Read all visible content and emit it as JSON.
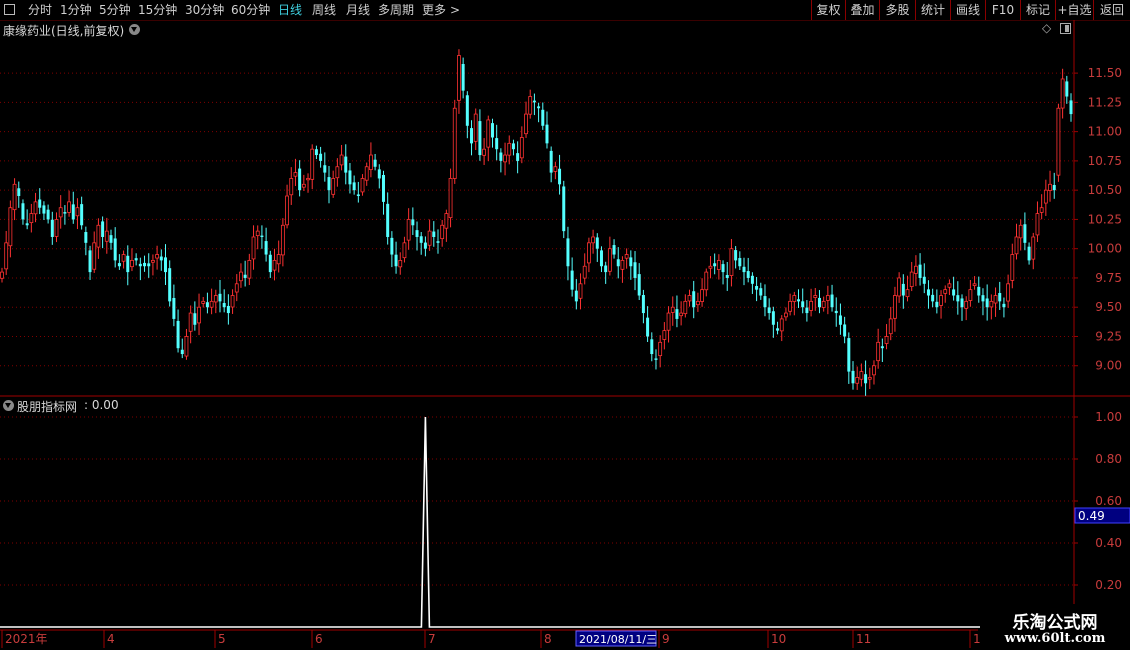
{
  "toolbar": {
    "periods": [
      "分时",
      "1分钟",
      "5分钟",
      "15分钟",
      "30分钟",
      "60分钟",
      "日线",
      "周线",
      "月线",
      "多周期",
      "更多"
    ],
    "active_period": "日线",
    "more_arrow": ">",
    "buttons": [
      "复权",
      "叠加",
      "多股",
      "统计",
      "画线",
      "F10",
      "标记",
      "+自选",
      "返回"
    ]
  },
  "main_panel": {
    "stock_title": "康缘药业(日线,前复权)",
    "dropdown_icon": "chevron-down-icon",
    "diamond_icon": "◇",
    "layout_icon": "panel-toggle-icon"
  },
  "indicator_panel": {
    "title": "股朋指标网",
    "value_text": ": 0.00",
    "cursor_value": "0.49"
  },
  "date_axis": {
    "labels": [
      "2021年",
      "4",
      "5",
      "6",
      "7",
      "8",
      "9",
      "10",
      "11",
      "1"
    ],
    "cursor_date": "2021/08/11/三"
  },
  "watermark": {
    "line1": "乐淘公式网",
    "line2": "www.60lt.com"
  },
  "colors": {
    "up": "#ff3232",
    "down": "#54ffff",
    "grid": "#800000",
    "axis_text": "#c83c3c",
    "indicator_line": "#ffffff",
    "cursor_box": "#000080"
  },
  "chart_data": [
    {
      "type": "candlestick",
      "title": "康缘药业(日线,前复权)",
      "y_ticks": [
        9.0,
        9.25,
        9.5,
        9.75,
        10.0,
        10.25,
        10.5,
        10.75,
        11.0,
        11.25,
        11.5
      ],
      "ylim": [
        8.75,
        11.8
      ],
      "x_month_labels": [
        "2021年",
        "4",
        "5",
        "6",
        "7",
        "8",
        "9",
        "10",
        "11",
        "1"
      ],
      "close": [
        9.8,
        10.05,
        10.35,
        10.55,
        10.45,
        10.25,
        10.2,
        10.3,
        10.4,
        10.35,
        10.3,
        10.25,
        10.1,
        10.25,
        10.35,
        10.3,
        10.4,
        10.25,
        10.35,
        10.2,
        10.05,
        9.8,
        10.05,
        10.2,
        10.1,
        10.15,
        10.05,
        9.9,
        9.85,
        9.95,
        9.8,
        9.9,
        9.9,
        9.85,
        9.85,
        9.85,
        9.9,
        9.95,
        9.9,
        9.8,
        9.55,
        9.4,
        9.15,
        9.1,
        9.25,
        9.45,
        9.35,
        9.5,
        9.55,
        9.5,
        9.55,
        9.6,
        9.55,
        9.5,
        9.45,
        9.6,
        9.7,
        9.8,
        9.75,
        9.9,
        10.1,
        10.15,
        10.1,
        9.95,
        9.8,
        9.9,
        9.95,
        10.2,
        10.45,
        10.6,
        10.65,
        10.5,
        10.55,
        10.6,
        10.85,
        10.8,
        10.75,
        10.65,
        10.5,
        10.6,
        10.7,
        10.8,
        10.65,
        10.55,
        10.5,
        10.45,
        10.6,
        10.7,
        10.8,
        10.7,
        10.6,
        10.4,
        10.1,
        9.95,
        9.85,
        9.9,
        10.05,
        10.25,
        10.2,
        10.1,
        10.05,
        10.0,
        10.15,
        10.1,
        10.05,
        10.2,
        10.3,
        10.6,
        11.2,
        11.65,
        11.35,
        11.05,
        10.9,
        11.15,
        10.8,
        10.85,
        11.1,
        10.95,
        10.85,
        10.75,
        10.8,
        10.9,
        10.85,
        10.75,
        10.95,
        11.15,
        11.3,
        11.25,
        11.2,
        11.05,
        10.9,
        10.65,
        10.7,
        10.55,
        10.15,
        9.85,
        9.65,
        9.55,
        9.7,
        9.85,
        10.05,
        10.1,
        10.0,
        9.85,
        9.8,
        10.0,
        9.95,
        9.85,
        9.9,
        9.95,
        9.85,
        9.75,
        9.6,
        9.45,
        9.25,
        9.1,
        9.05,
        9.2,
        9.3,
        9.45,
        9.5,
        9.4,
        9.45,
        9.55,
        9.6,
        9.5,
        9.55,
        9.65,
        9.8,
        9.85,
        9.85,
        9.9,
        9.8,
        9.75,
        10.0,
        9.9,
        9.85,
        9.8,
        9.75,
        9.7,
        9.65,
        9.6,
        9.5,
        9.45,
        9.35,
        9.3,
        9.4,
        9.45,
        9.55,
        9.6,
        9.55,
        9.5,
        9.45,
        9.55,
        9.6,
        9.5,
        9.55,
        9.6,
        9.5,
        9.45,
        9.35,
        9.25,
        8.95,
        8.85,
        8.9,
        8.95,
        8.85,
        8.9,
        9.0,
        9.2,
        9.15,
        9.25,
        9.4,
        9.6,
        9.75,
        9.6,
        9.65,
        9.8,
        9.85,
        9.75,
        9.7,
        9.6,
        9.55,
        9.5,
        9.6,
        9.65,
        9.7,
        9.6,
        9.55,
        9.5,
        9.55,
        9.65,
        9.7,
        9.6,
        9.55,
        9.5,
        9.55,
        9.6,
        9.55,
        9.5,
        9.7,
        9.95,
        10.1,
        10.2,
        10.05,
        9.9,
        10.1,
        10.3,
        10.35,
        10.5,
        10.55,
        10.5,
        11.2,
        11.45,
        11.3,
        11.15
      ],
      "indicator": {
        "name": "股朋指标网",
        "y_ticks": [
          0.2,
          0.4,
          0.6,
          0.8,
          1.0
        ],
        "values_note": "zero everywhere except spike of 1.00 at first trading day of July",
        "spike_value": 1.0,
        "spike_index": 101,
        "current_value": 0.0
      }
    }
  ]
}
